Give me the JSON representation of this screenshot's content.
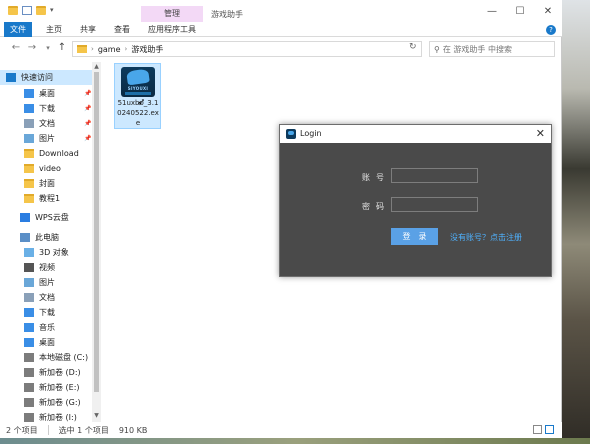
{
  "window": {
    "manage_tab": "管理",
    "title": "游戏助手",
    "controls": {
      "minimize": "—",
      "maximize": "☐",
      "close": "✕"
    }
  },
  "ribbon": {
    "tabs": [
      "文件",
      "主页",
      "共享",
      "查看",
      "应用程序工具"
    ],
    "help": "?"
  },
  "address": {
    "parts": [
      "game",
      "游戏助手"
    ],
    "search_placeholder": "在 游戏助手 中搜索"
  },
  "sidebar": {
    "items": [
      {
        "label": "快速访问",
        "icon": "star-icon",
        "pinned": false
      },
      {
        "label": "桌面",
        "icon": "desktop-icon",
        "pinned": true
      },
      {
        "label": "下载",
        "icon": "download-icon",
        "pinned": true
      },
      {
        "label": "文档",
        "icon": "document-icon",
        "pinned": true
      },
      {
        "label": "图片",
        "icon": "picture-icon",
        "pinned": true
      },
      {
        "label": "Download",
        "icon": "folder-icon",
        "pinned": false
      },
      {
        "label": "video",
        "icon": "folder-icon",
        "pinned": false
      },
      {
        "label": "封面",
        "icon": "folder-icon",
        "pinned": false
      },
      {
        "label": "教程1",
        "icon": "folder-icon",
        "pinned": false
      },
      {
        "label": "WPS云盘",
        "icon": "cloud-icon",
        "pinned": false
      },
      {
        "label": "此电脑",
        "icon": "computer-icon",
        "pinned": false
      },
      {
        "label": "3D 对象",
        "icon": "cube-icon",
        "pinned": false
      },
      {
        "label": "视频",
        "icon": "video-icon",
        "pinned": false
      },
      {
        "label": "图片",
        "icon": "picture-icon",
        "pinned": false
      },
      {
        "label": "文档",
        "icon": "document-icon",
        "pinned": false
      },
      {
        "label": "下载",
        "icon": "download-icon",
        "pinned": false
      },
      {
        "label": "音乐",
        "icon": "music-icon",
        "pinned": false
      },
      {
        "label": "桌面",
        "icon": "desktop-icon",
        "pinned": false
      },
      {
        "label": "本地磁盘 (C:)",
        "icon": "drive-icon",
        "pinned": false
      },
      {
        "label": "新加卷 (D:)",
        "icon": "drive-icon",
        "pinned": false
      },
      {
        "label": "新加卷 (E:)",
        "icon": "drive-icon",
        "pinned": false
      },
      {
        "label": "新加卷 (G:)",
        "icon": "drive-icon",
        "pinned": false
      },
      {
        "label": "新加卷 (I:)",
        "icon": "drive-icon",
        "pinned": false
      }
    ]
  },
  "file": {
    "brand": "SIYOUXI",
    "name": "51uxbo_3.10240522.exe"
  },
  "status": {
    "count": "2 个项目",
    "selected": "选中 1 个项目",
    "size": "910 KB"
  },
  "login": {
    "title": "Login",
    "account_label": "账号",
    "password_label": "密码",
    "login_button": "登录",
    "register_link": "没有账号？点击注册"
  },
  "colors": {
    "accent": "#1979ca",
    "selection": "#cce8ff",
    "dialog_bg": "#4a4a4a",
    "login_button": "#5aa1e6",
    "link": "#4fb2ff"
  }
}
